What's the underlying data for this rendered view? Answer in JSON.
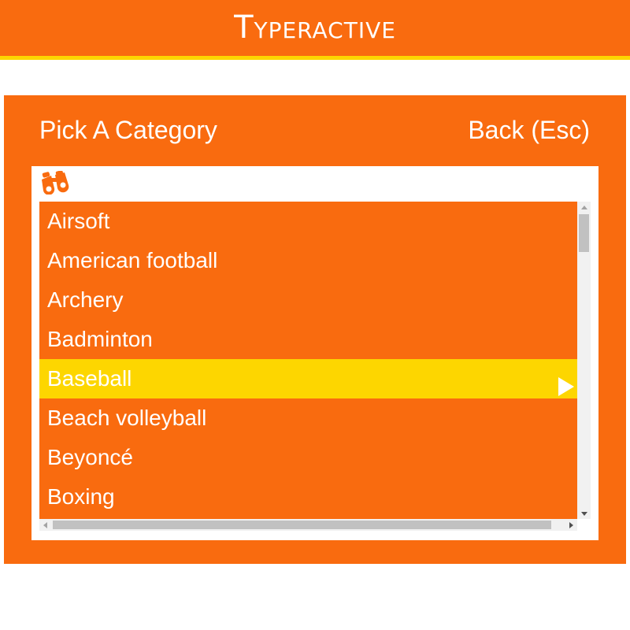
{
  "app": {
    "title": "Typeractive"
  },
  "panel": {
    "title": "Pick A Category",
    "back_label": "Back (Esc)"
  },
  "search": {
    "icon": "binoculars-icon"
  },
  "categories": {
    "items": [
      {
        "label": "Airsoft"
      },
      {
        "label": "American football"
      },
      {
        "label": "Archery"
      },
      {
        "label": "Badminton"
      },
      {
        "label": "Baseball",
        "selected": true
      },
      {
        "label": "Beach volleyball"
      },
      {
        "label": "Beyoncé"
      },
      {
        "label": "Boxing"
      }
    ],
    "selected_icon": "play-arrow-icon"
  },
  "colors": {
    "brand_orange": "#f96b0f",
    "highlight_yellow": "#fdd600",
    "text": "#ffffff"
  }
}
